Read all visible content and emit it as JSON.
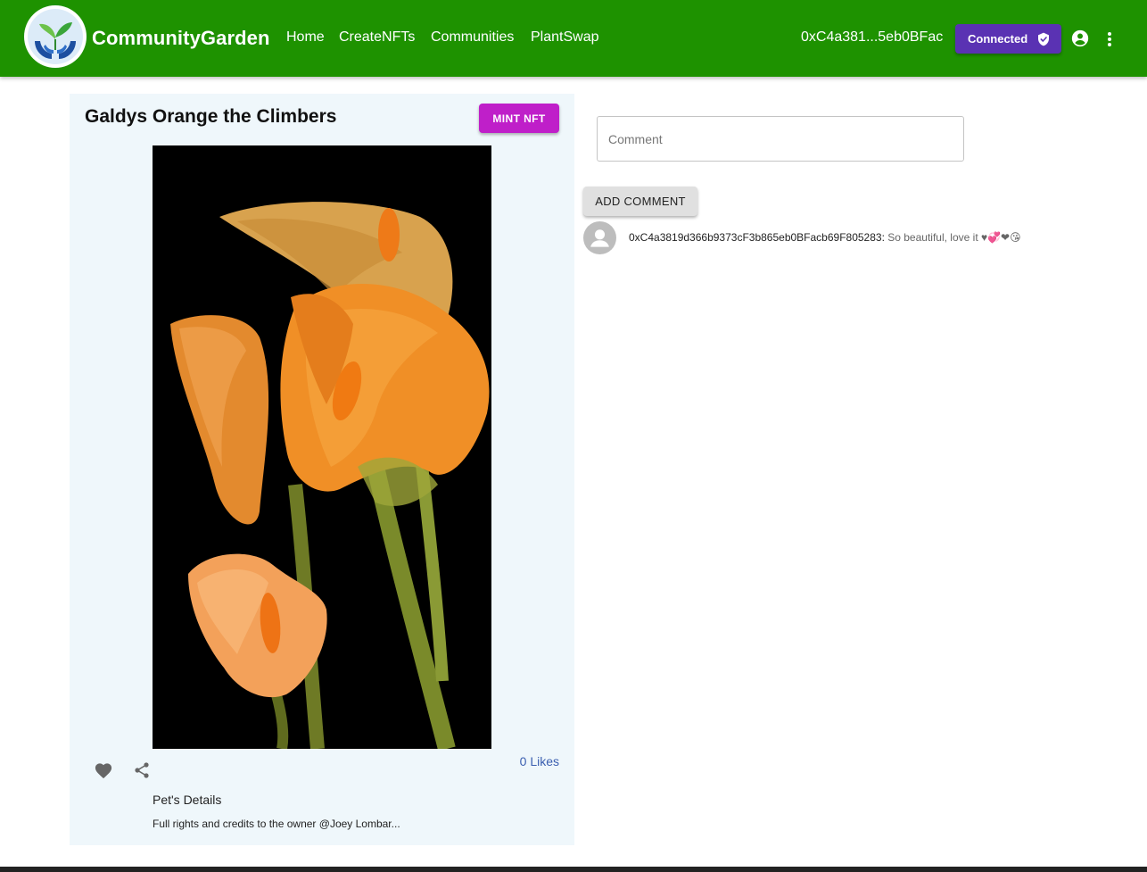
{
  "header": {
    "brand": "CommunityGarden",
    "nav": [
      {
        "label": "Home"
      },
      {
        "label": "CreateNFTs"
      },
      {
        "label": "Communities"
      },
      {
        "label": "PlantSwap"
      }
    ],
    "wallet_address": "0xC4a381...5eb0BFac",
    "connected_label": "Connected",
    "icons": [
      "community-garden-logo",
      "shield-check-icon",
      "account-circle-icon",
      "more-vert-icon"
    ],
    "colors": {
      "appbar": "#1e9200",
      "connected_button": "#5a32b3"
    }
  },
  "nft": {
    "title": "Galdys Orange the Climbers",
    "mint_label": "MINT NFT",
    "likes": "0 Likes",
    "details_title": "Pet's Details",
    "details_text": "Full rights and credits to the owner @Joey Lombar...",
    "icons": [
      "heart-icon",
      "share-icon"
    ],
    "colors": {
      "mint_button": "#bf1fc9",
      "card_background": "#eff7fb"
    }
  },
  "comments": {
    "placeholder": "Comment",
    "add_label": "ADD COMMENT",
    "items": [
      {
        "author": "0xC4a3819d366b9373cF3b865eb0BFacb69F805283:",
        "text": "So beautiful, love it ♥💞❤😘"
      }
    ]
  }
}
